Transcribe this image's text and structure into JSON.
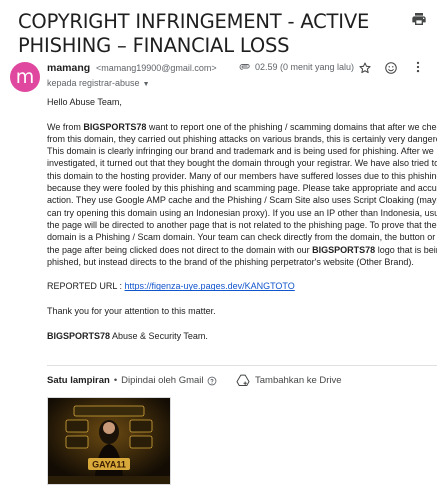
{
  "email": {
    "subject": "COPYRIGHT INFRINGEMENT - ACTIVE PHISHING – FINANCIAL LOSS",
    "sender_initial": "m",
    "sender_name": "mamang",
    "sender_email": "<mamang19900@gmail.com>",
    "to_label": "kepada registrar-abuse",
    "timestamp": "02.59 (0 menit yang lalu)",
    "greeting": "Hello Abuse Team,",
    "para1": [
      {
        "parts": [
          {
            "t": "We from "
          },
          {
            "b": "BIGSPORTS78"
          },
          {
            "t": " want to report one of the phishing / scamming domains that after we checke"
          }
        ]
      },
      {
        "parts": [
          {
            "t": "from this domain, they carried out phishing attacks on various brands, this is certainly very dangerous"
          }
        ]
      },
      {
        "parts": [
          {
            "t": "This domain is clearly infringing our brand and trademark and is being used for phishing. After we"
          }
        ]
      },
      {
        "parts": [
          {
            "t": "investigated, it turned out that they bought the domain through your registrar. We have also tried to re"
          }
        ]
      },
      {
        "parts": [
          {
            "t": "this domain to the hosting provider. Many of our members have suffered losses due to this phishing pa"
          }
        ]
      },
      {
        "parts": [
          {
            "t": "because they were fooled by this phishing and scamming page. Please take appropriate and accurate"
          }
        ]
      },
      {
        "parts": [
          {
            "t": "action. They use Google AMP cache and the Phishing / Scam Site also uses Script Cloaking (maybe y"
          }
        ]
      },
      {
        "parts": [
          {
            "t": "can try opening this domain using an Indonesian proxy). If you use an IP other than Indonesia, usuall"
          }
        ]
      },
      {
        "parts": [
          {
            "t": "the page will be directed to another page that is not related to the phishing page. To prove that the"
          }
        ]
      },
      {
        "parts": [
          {
            "t": "domain is a Phishing / Scam domain. Your team can check directly from the domain, the button or link"
          }
        ]
      },
      {
        "parts": [
          {
            "t": "the page after being clicked does not direct to the domain with our "
          },
          {
            "b": "BIGSPORTS78"
          },
          {
            "t": " logo that is being"
          }
        ]
      },
      {
        "parts": [
          {
            "t": "phished, but instead directs to the brand of the phishing perpetrator's website (Other Brand)."
          }
        ]
      }
    ],
    "reported_label": "REPORTED URL : ",
    "reported_url": "https://figenza-uye.pages.dev/KANGTOTO",
    "thanks": "Thank you for your attention to this matter.",
    "sign_brand": "BIGSPORTS78",
    "sign_rest": " Abuse & Security Team."
  },
  "attachments": {
    "count_label": "Satu lampiran",
    "scan_label": "Dipindai oleh Gmail",
    "drive_label": "Tambahkan ke Drive",
    "thumb_text": "GAYA11"
  },
  "colors": {
    "avatar": "#e0479e",
    "link": "#1155cc",
    "thumb_bg": "#1a1208",
    "thumb_gold": "#d8a93a"
  }
}
